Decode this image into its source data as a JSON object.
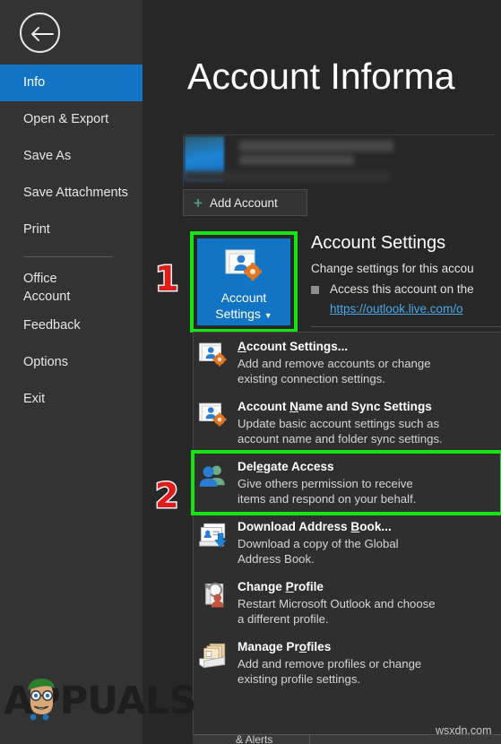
{
  "sidebar": {
    "back_icon": "back-arrow-icon",
    "items": [
      {
        "label": "Info",
        "selected": true
      },
      {
        "label": "Open & Export",
        "selected": false
      },
      {
        "label": "Save As",
        "selected": false
      },
      {
        "label": "Save Attachments",
        "selected": false
      },
      {
        "label": "Print",
        "selected": false
      }
    ],
    "items_lower": [
      {
        "label": "Office Account",
        "two_line": true
      },
      {
        "label": "Feedback",
        "two_line": false
      },
      {
        "label": "Options",
        "two_line": false
      },
      {
        "label": "Exit",
        "two_line": false
      }
    ]
  },
  "header": {
    "title": "Account Informa"
  },
  "account": {
    "add_account_label": "Add Account",
    "add_account_icon": "plus-icon",
    "avatar_icon": "account-avatar"
  },
  "tile": {
    "label_line1": "Account",
    "label_line2": "Settings",
    "caret": "▼",
    "icon": "account-settings-icon",
    "highlight_color": "#14e414",
    "tile_color": "#1274c4"
  },
  "details": {
    "heading": "Account Settings",
    "subtitle": "Change settings for this accou",
    "bullet": "Access this account on the",
    "link": "https://outlook.live.com/o",
    "link_color": "#4aa8e8"
  },
  "menu": {
    "items": [
      {
        "title_pre": "",
        "title_underline": "A",
        "title_post": "ccount Settings...",
        "desc_line1": "Add and remove accounts or change",
        "desc_line2": "existing connection settings.",
        "icon": "account-settings-icon",
        "highlighted": false
      },
      {
        "title_pre": "Account ",
        "title_underline": "N",
        "title_post": "ame and Sync Settings",
        "desc_line1": "Update basic account settings such as",
        "desc_line2": "account name and folder sync settings.",
        "icon": "account-settings-icon",
        "highlighted": false
      },
      {
        "title_pre": "Del",
        "title_underline": "e",
        "title_post": "gate Access",
        "desc_line1": "Give others permission to receive",
        "desc_line2": "items and respond on your behalf.",
        "icon": "delegate-access-icon",
        "highlighted": true
      },
      {
        "title_pre": "Download Address ",
        "title_underline": "B",
        "title_post": "ook...",
        "desc_line1": "Download a copy of the Global",
        "desc_line2": "Address Book.",
        "icon": "download-address-book-icon",
        "highlighted": false
      },
      {
        "title_pre": "Change ",
        "title_underline": "P",
        "title_post": "rofile",
        "desc_line1": "Restart Microsoft Outlook and choose",
        "desc_line2": "a different profile.",
        "icon": "change-profile-icon",
        "highlighted": false
      },
      {
        "title_pre": "Manage Pr",
        "title_underline": "o",
        "title_post": "files",
        "desc_line1": "Add and remove profiles or change",
        "desc_line2": "existing profile settings.",
        "icon": "manage-profiles-icon",
        "highlighted": false
      }
    ]
  },
  "bottom_strip": {
    "text": "& Alerts"
  },
  "markers": {
    "one": "1",
    "two": "2",
    "color": "#e01b1b"
  },
  "watermarks": {
    "appuals": "APPUALS",
    "wsxdn": "wsxdn.com"
  }
}
